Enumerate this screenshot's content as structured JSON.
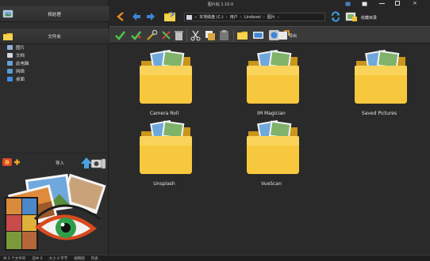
{
  "window": {
    "title": "图片帖 1.10.0"
  },
  "sidebar": {
    "buttons": [
      {
        "label": "相处理",
        "icon": "image-edit-icon"
      },
      {
        "label": "文件夹",
        "icon": "folder-icon"
      }
    ],
    "tree": [
      {
        "label": "图片",
        "icon": "pictures-icon",
        "color": "#8fb3d9"
      },
      {
        "label": "文档",
        "icon": "documents-icon",
        "color": "#cfd6de"
      },
      {
        "label": "此电脑",
        "icon": "computer-icon",
        "color": "#6aa0d8"
      },
      {
        "label": "网络",
        "icon": "network-icon",
        "color": "#5b9bd5"
      },
      {
        "label": "桌面",
        "icon": "desktop-icon",
        "color": "#3f8fe0"
      }
    ],
    "add_label": "导入"
  },
  "address": {
    "segments": [
      "本地磁盘 (C:)",
      "用户",
      "Lindavei",
      "图片"
    ]
  },
  "favorites": {
    "label": "收藏目录"
  },
  "toolbar": {
    "export_label": "导出"
  },
  "folders": [
    {
      "name": "Camera Roll"
    },
    {
      "name": "IM Magician"
    },
    {
      "name": "Saved Pictures"
    },
    {
      "name": "Unsplash"
    },
    {
      "name": "VueScan"
    }
  ],
  "status": {
    "items": [
      "共 5 个文件夹",
      "选中 0",
      "大小 0 字节",
      "缩略图",
      "列表"
    ]
  }
}
